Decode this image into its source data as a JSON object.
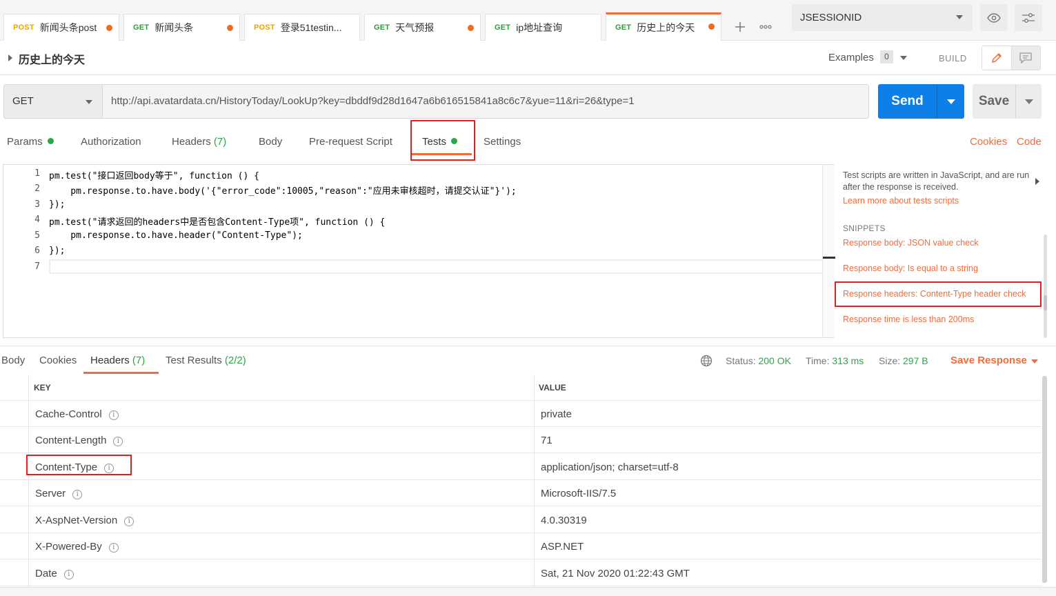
{
  "tabs": [
    {
      "method": "POST",
      "name": "新闻头条post",
      "unsaved": true
    },
    {
      "method": "GET",
      "name": "新闻头条",
      "unsaved": true
    },
    {
      "method": "POST",
      "name": "登录51testin...",
      "unsaved": false
    },
    {
      "method": "GET",
      "name": "天气预报",
      "unsaved": true
    },
    {
      "method": "GET",
      "name": "ip地址查询",
      "unsaved": false
    },
    {
      "method": "GET",
      "name": "历史上的今天",
      "unsaved": true,
      "active": true
    }
  ],
  "tab_actions": {
    "add_icon": "plus-icon",
    "more_icon": "more-icon"
  },
  "environment": {
    "selected": "JSESSIONID"
  },
  "request": {
    "title": "历史上的今天",
    "examples_label": "Examples",
    "examples_count": "0",
    "build_label": "BUILD",
    "method": "GET",
    "url": "http://api.avatardata.cn/HistoryToday/LookUp?key=dbddf9d28d1647a6b616515841a8c6c7&yue=11&ri=26&type=1",
    "send_label": "Send",
    "save_label": "Save"
  },
  "request_tabs": {
    "params": "Params",
    "authorization": "Authorization",
    "headers": "Headers",
    "headers_count": "(7)",
    "body": "Body",
    "prerequest": "Pre-request Script",
    "tests": "Tests",
    "settings": "Settings",
    "cookies_link": "Cookies",
    "code_link": "Code"
  },
  "editor": {
    "line_numbers": [
      "1",
      "2",
      "3",
      "4",
      "5",
      "6",
      "7"
    ],
    "lines": [
      "pm.test(\"接口返回body等于\", function () {",
      "    pm.response.to.have.body('{\"error_code\":10005,\"reason\":\"应用未审核超时，请提交认证\"}');",
      "});",
      "pm.test(\"请求返回的headers中是否包含Content-Type项\", function () {",
      "    pm.response.to.have.header(\"Content-Type\");",
      "});",
      ""
    ]
  },
  "snippets_panel": {
    "help_text": "Test scripts are written in JavaScript, and are run after the response is received.",
    "learn_more": "Learn more about tests scripts",
    "heading": "SNIPPETS",
    "items": [
      "Response body: JSON value check",
      "Response body: Is equal to a string",
      "Response headers: Content-Type header check",
      "Response time is less than 200ms"
    ]
  },
  "response": {
    "tabs": {
      "body": "Body",
      "cookies": "Cookies",
      "headers": "Headers",
      "headers_count": "(7)",
      "test_results": "Test Results",
      "test_results_count": "(2/2)"
    },
    "status_label": "Status:",
    "status_value": "200 OK",
    "time_label": "Time:",
    "time_value": "313 ms",
    "size_label": "Size:",
    "size_value": "297 B",
    "save_response": "Save Response",
    "table": {
      "key_header": "KEY",
      "value_header": "VALUE",
      "rows": [
        {
          "key": "Cache-Control",
          "value": "private"
        },
        {
          "key": "Content-Length",
          "value": "71"
        },
        {
          "key": "Content-Type",
          "value": "application/json; charset=utf-8"
        },
        {
          "key": "Server",
          "value": "Microsoft-IIS/7.5"
        },
        {
          "key": "X-AspNet-Version",
          "value": "4.0.30319"
        },
        {
          "key": "X-Powered-By",
          "value": "ASP.NET"
        },
        {
          "key": "Date",
          "value": "Sat, 21 Nov 2020 01:22:43 GMT"
        }
      ]
    }
  },
  "colors": {
    "accent": "#f26b3a",
    "send_blue": "#0d7fe9",
    "success_green": "#28a745",
    "post_yellow": "#e8a600",
    "get_green": "#2e9a3f",
    "highlight_red": "#e02020"
  }
}
